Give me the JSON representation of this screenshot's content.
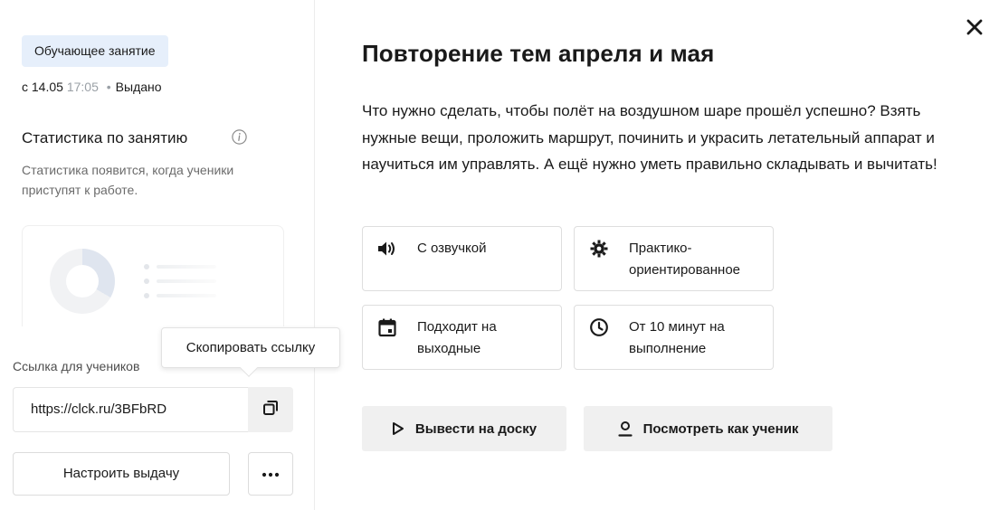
{
  "sidebar": {
    "badge": "Обучающее занятие",
    "issued": {
      "prefix": "с",
      "date": "14.05",
      "time": "17:05",
      "separator": "•",
      "status": "Выдано"
    },
    "stats_title": "Статистика по занятию",
    "stats_desc": "Статистика появится, когда ученики приступят к работе.",
    "link_label": "Ссылка для учеников",
    "link_value": "https://clck.ru/3BFbRD",
    "tooltip": "Скопировать ссылку",
    "setup_button": "Настроить выдачу",
    "more_button": "⋯"
  },
  "main": {
    "title": "Повторение тем апреля и мая",
    "description": "Что нужно сделать, чтобы полёт на воздушном шаре прошёл успешно? Взять нужные вещи, проложить маршрут, починить и украсить летательный аппарат и научиться им управлять. А ещё нужно уметь правильно складывать и вычитать!",
    "features": [
      {
        "icon": "speaker-icon",
        "label": "С озвучкой"
      },
      {
        "icon": "gear-icon",
        "label": "Практико-ориентированное"
      },
      {
        "icon": "calendar-icon",
        "label": "Подходит на выходные"
      },
      {
        "icon": "clock-icon",
        "label": "От 10 минут на выполнение"
      }
    ],
    "actions": {
      "board": "Вывести на доску",
      "preview": "Посмотреть как ученик"
    }
  },
  "colors": {
    "badge_bg": "#e6effb",
    "button_bg": "#f0f0f0",
    "muted_text": "#6b6b6b"
  }
}
